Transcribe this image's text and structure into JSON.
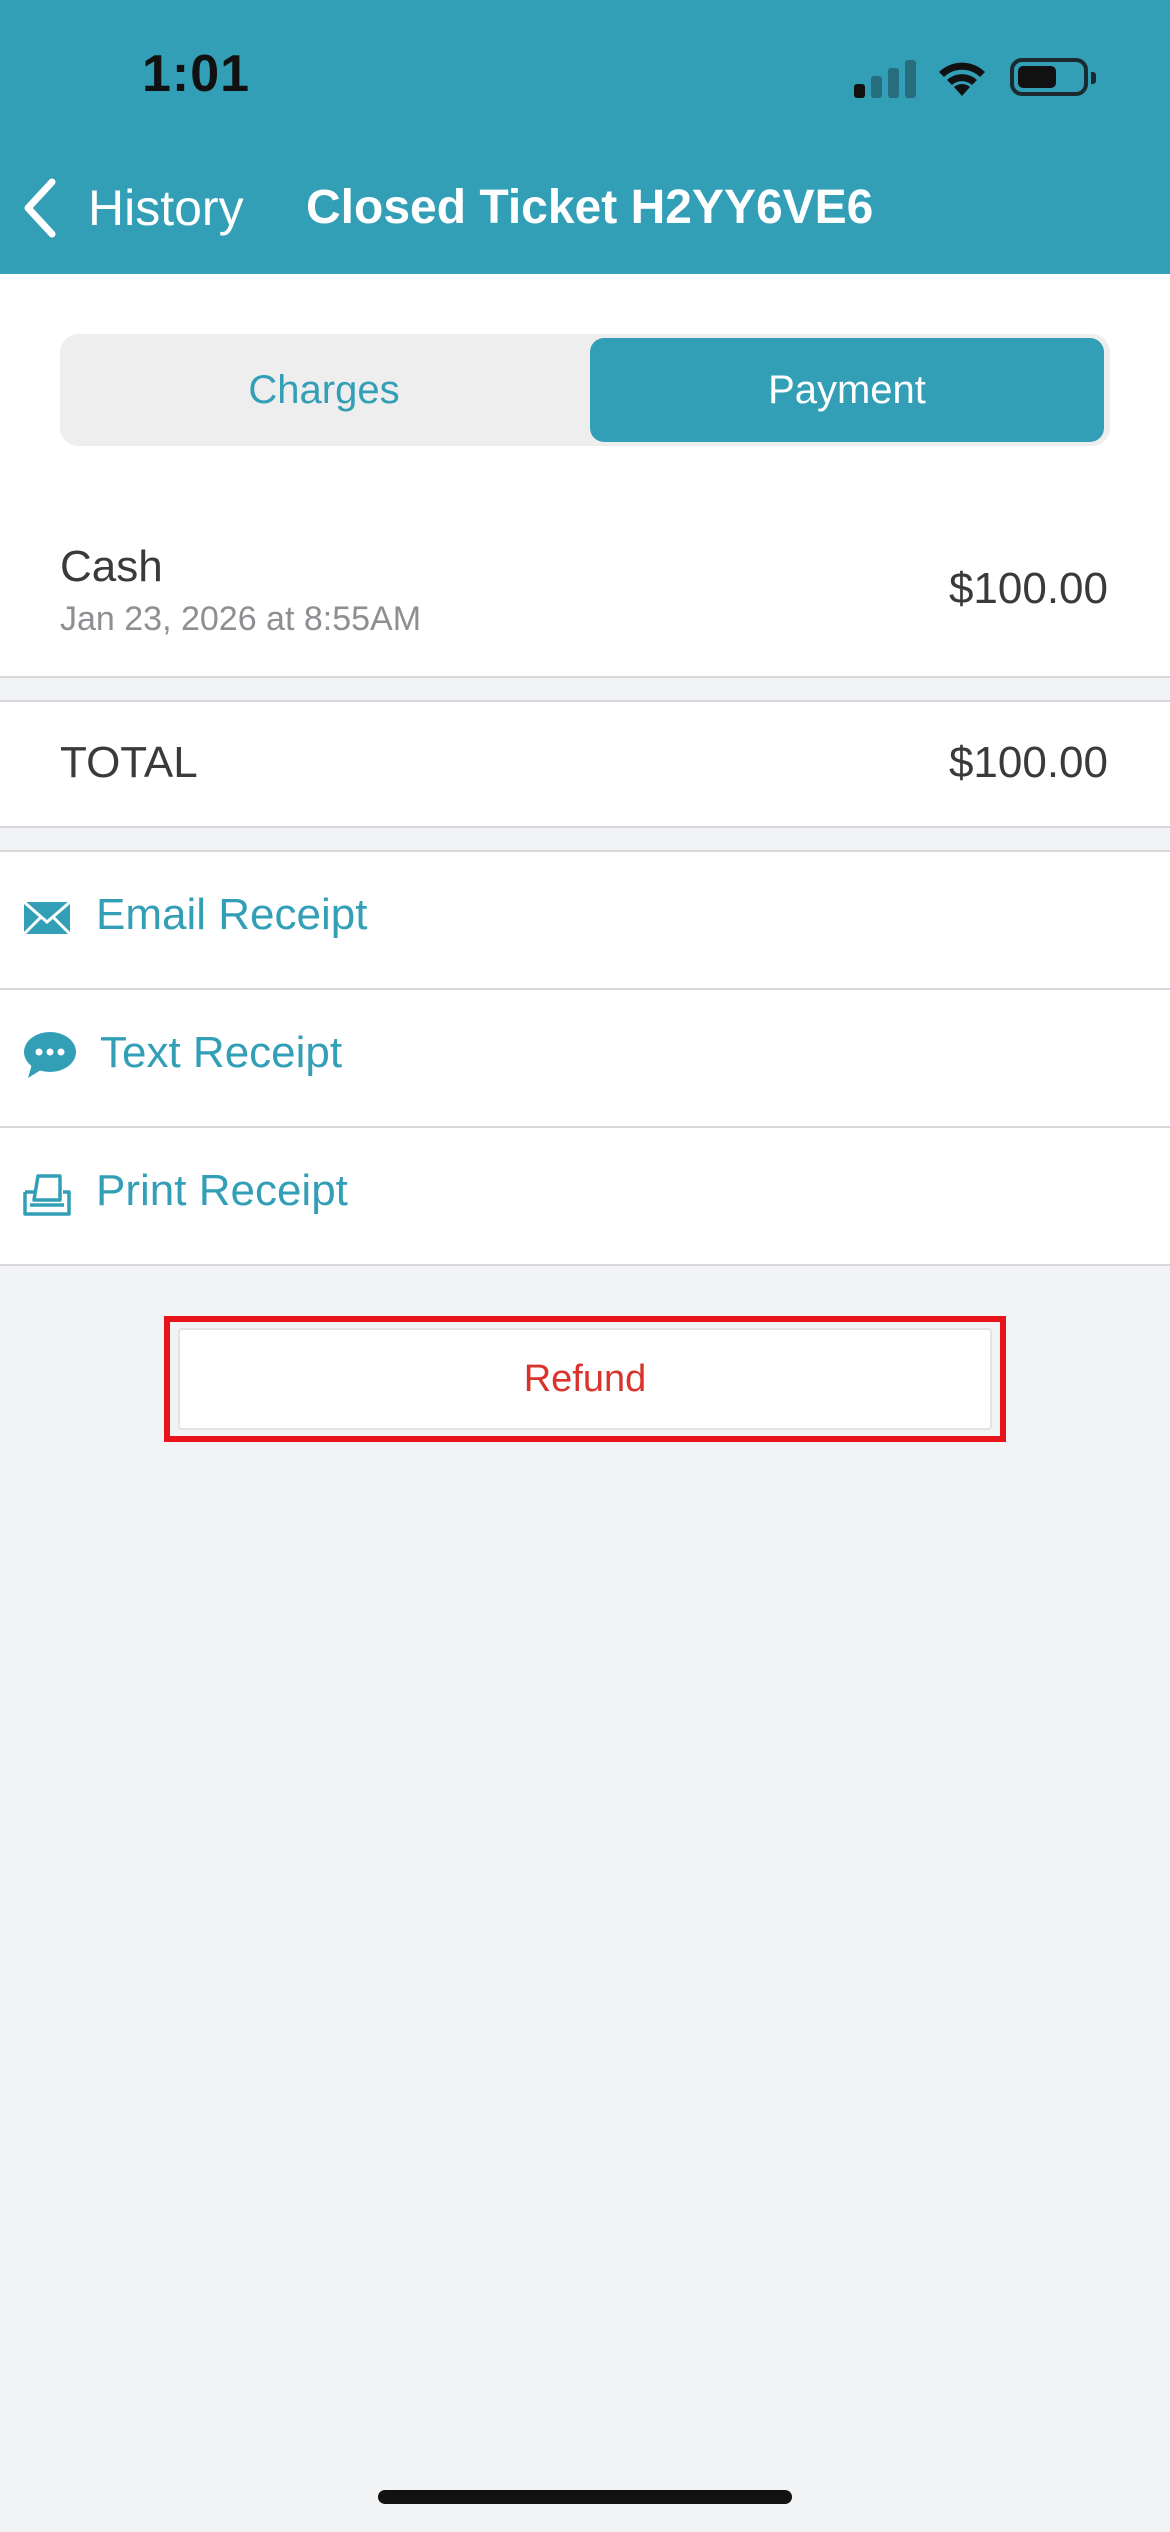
{
  "status_bar": {
    "time": "1:01"
  },
  "nav": {
    "back_label": "History",
    "title": "Closed Ticket H2YY6VE6"
  },
  "tabs": [
    {
      "label": "Charges",
      "selected": false
    },
    {
      "label": "Payment",
      "selected": true
    }
  ],
  "payment": {
    "method": "Cash",
    "date": "Jan 23, 2026 at 8:55AM",
    "amount": "$100.00"
  },
  "total": {
    "label": "TOTAL",
    "amount": "$100.00"
  },
  "receipts": [
    {
      "label": "Email Receipt",
      "icon": "envelope-icon"
    },
    {
      "label": "Text Receipt",
      "icon": "speech-bubble-icon"
    },
    {
      "label": "Print Receipt",
      "icon": "printer-icon"
    }
  ],
  "refund": {
    "label": "Refund"
  },
  "colors": {
    "accent": "#329fb7",
    "refund_text": "#d9342b",
    "highlight": "#e8141b",
    "background": "#f2f3f5"
  }
}
